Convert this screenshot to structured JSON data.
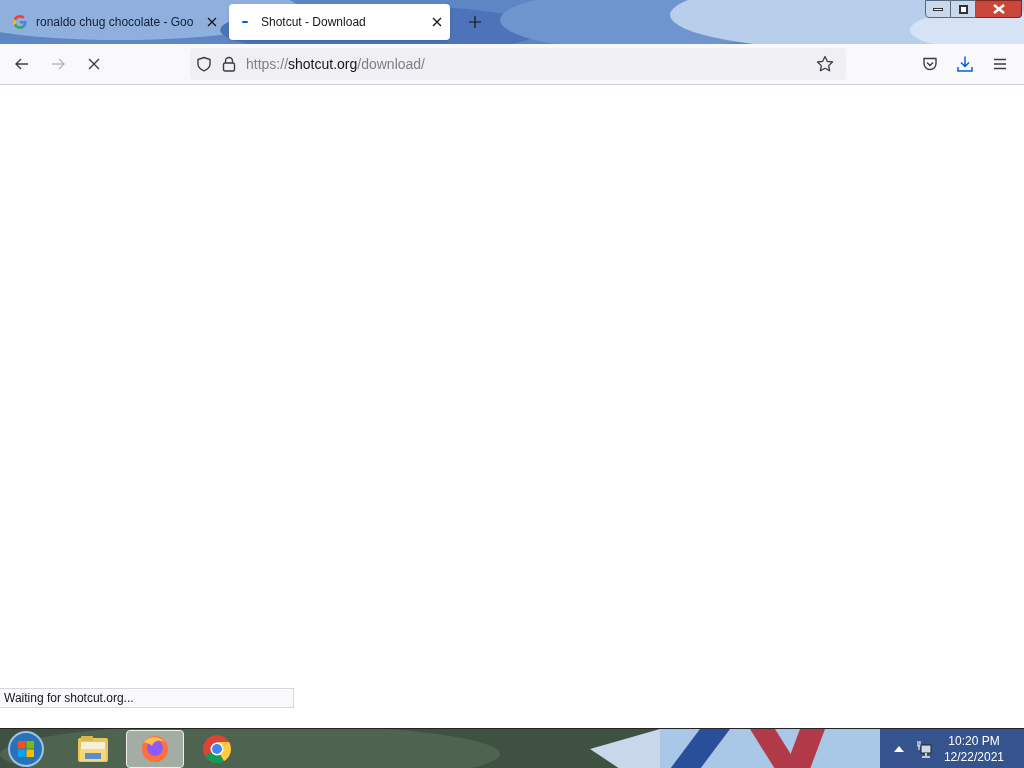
{
  "tabs": [
    {
      "title": "ronaldo chug chocolate - Goo",
      "kind": "google",
      "selected": false
    },
    {
      "title": "Shotcut - Download",
      "kind": "loading",
      "selected": true
    }
  ],
  "nav_buttons": [
    {
      "kind": "back",
      "disabled": false
    },
    {
      "kind": "forward",
      "disabled": true
    },
    {
      "kind": "stop",
      "disabled": false
    }
  ],
  "address_bar": {
    "scheme": "https://",
    "host": "shotcut.org",
    "path": "/download/"
  },
  "status_text": "Waiting for shotcut.org...",
  "taskbar": {
    "items": [
      {
        "kind": "explorer",
        "selected": false
      },
      {
        "kind": "firefox",
        "selected": true
      },
      {
        "kind": "chrome",
        "selected": false
      }
    ],
    "time": "10:20 PM",
    "date": "12/22/2021"
  }
}
